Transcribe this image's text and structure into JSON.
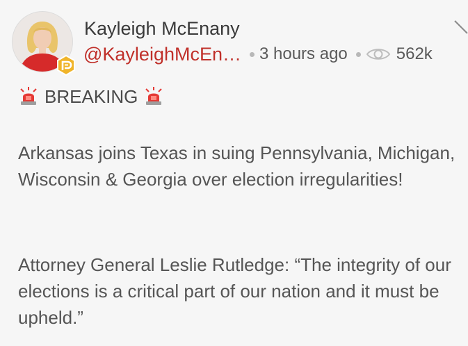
{
  "post": {
    "display_name": "Kayleigh McEnany",
    "handle": "@KayleighMcEn…",
    "time_ago": "3 hours ago",
    "views": "562k",
    "breaking_label": "BREAKING",
    "paragraph_1": "Arkansas joins Texas in suing Pennsylvania, Michigan, Wisconsin & Georgia over election irregularities!",
    "paragraph_2": "Attorney General Leslie Rutledge: “The integrity of our elections is a critical part of our nation and it must be upheld.”"
  },
  "icons": {
    "badge": "parler-verified-badge",
    "views": "eye-icon",
    "menu": "chevron-down-icon",
    "siren": "rotating-light-emoji"
  },
  "colors": {
    "background": "#f6f6f6",
    "handle": "#c0302a",
    "badge": "#f0b429",
    "name": "#3a3a3a",
    "body_text": "#555555"
  }
}
